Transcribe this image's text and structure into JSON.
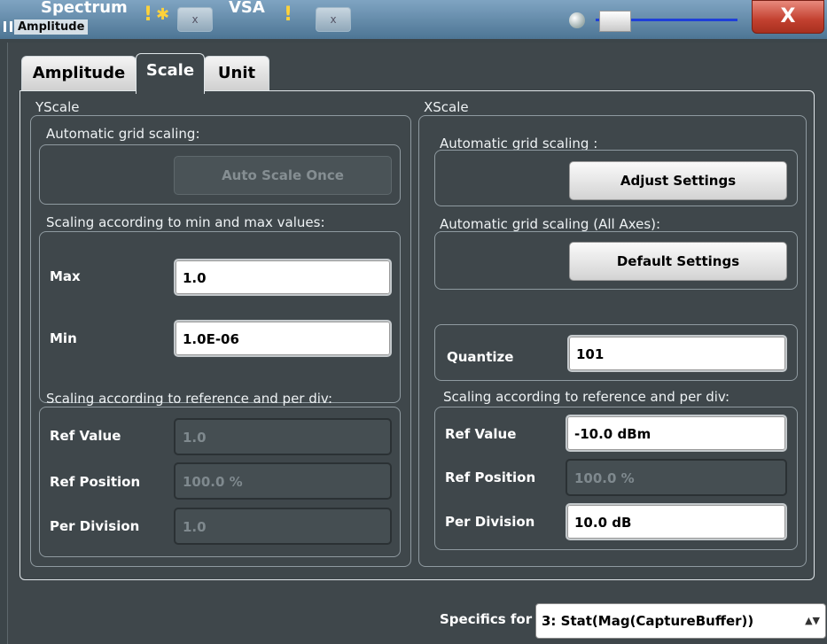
{
  "app": {
    "bg_tabs": [
      {
        "label": "Spectrum",
        "close": "x"
      },
      {
        "label": "VSA",
        "close": "x"
      }
    ],
    "warn_glyph": "!",
    "star_glyph": "✱",
    "close_glyph": "X"
  },
  "dialog": {
    "title": "Amplitude",
    "tabs": [
      {
        "label": "Amplitude",
        "active": false
      },
      {
        "label": "Scale",
        "active": true
      },
      {
        "label": "Unit",
        "active": false
      }
    ]
  },
  "yscale": {
    "title": "YScale",
    "auto_title": "Automatic grid scaling:",
    "auto_button": "Auto Scale Once",
    "minmax_title": "Scaling according to min and max values:",
    "max_label": "Max",
    "max_value": "1.0",
    "min_label": "Min",
    "min_value": "1.0E-06",
    "ref_title": "Scaling according to reference and per div:",
    "ref_value_label": "Ref Value",
    "ref_value": "1.0",
    "ref_position_label": "Ref Position",
    "ref_position": "100.0 %",
    "per_division_label": "Per Division",
    "per_division": "1.0"
  },
  "xscale": {
    "title": "XScale",
    "auto_title": "Automatic grid scaling :",
    "adjust_button": "Adjust Settings",
    "auto_all_title": "Automatic grid scaling (All Axes):",
    "default_button": "Default Settings",
    "quantize_label": "Quantize",
    "quantize_value": "101",
    "ref_title": "Scaling according to reference and per div:",
    "ref_value_label": "Ref Value",
    "ref_value": "-10.0 dBm",
    "ref_position_label": "Ref Position",
    "ref_position": "100.0 %",
    "per_division_label": "Per Division",
    "per_division": "10.0 dB"
  },
  "footer": {
    "specifics_label": "Specifics for",
    "specifics_value": "3: Stat(Mag(CaptureBuffer))",
    "arrow_glyph": "▲▼"
  },
  "colors": {
    "dialog_bg": "#3f474b",
    "close_red": "#c2402f",
    "slider_blue": "#1f3fd8"
  }
}
